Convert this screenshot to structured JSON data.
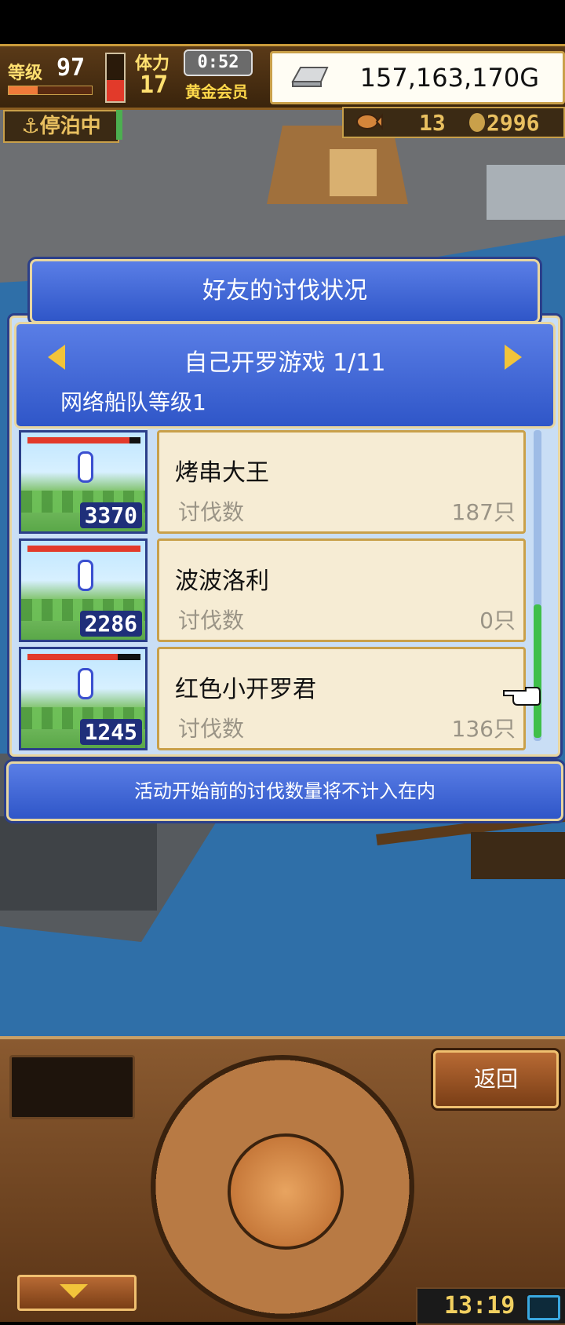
{
  "hud": {
    "level_label": "等级",
    "level_value": "97",
    "exp_fraction": 0.35,
    "stamina_label": "体力",
    "stamina_value": "17",
    "stamina_fraction": 0.45,
    "timer": "0:52",
    "membership": "黄金会员",
    "money": "157,163,170G",
    "port_status": "停泊中",
    "ration_count": "13",
    "coin_count": "2996"
  },
  "dialog": {
    "title": "好友的讨伐状况",
    "event_name": "自己开罗游戏 1/11",
    "fleet_level": "网络船队等级1",
    "notice": "活动开始前的讨伐数量将不计入在内",
    "rows": [
      {
        "name": "烤串大王",
        "kill_label": "讨伐数",
        "kill_value": "187只",
        "score": "3370",
        "hp_fraction": 0.9
      },
      {
        "name": "波波洛利",
        "kill_label": "讨伐数",
        "kill_value": "0只",
        "score": "2286",
        "hp_fraction": 1.0
      },
      {
        "name": "红色小开罗君",
        "kill_label": "讨伐数",
        "kill_value": "136只",
        "score": "1245",
        "hp_fraction": 0.8
      }
    ]
  },
  "controls": {
    "back_label": "返回",
    "clock": "13:19"
  },
  "colors": {
    "panel_blue": "#2f56c8",
    "gold_border": "#e8d6a0",
    "card_bg": "#f6ecd4",
    "water": "#2f6fa8"
  },
  "icons": [
    "silver-ingot-icon",
    "anchor-icon",
    "fish-icon",
    "coin-icon",
    "arrow-left-icon",
    "arrow-right-icon",
    "pointing-hand-icon",
    "battery-charging-icon"
  ]
}
